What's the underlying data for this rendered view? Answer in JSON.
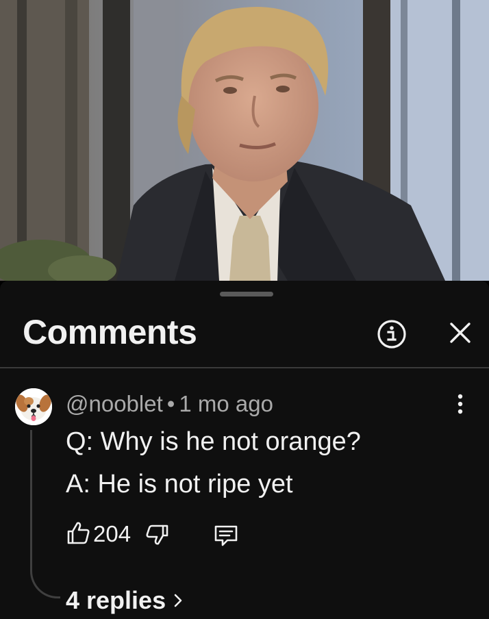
{
  "video": {
    "description_icon": "video-frame"
  },
  "comments_panel": {
    "title": "Comments",
    "info_icon": "info-icon",
    "close_icon": "close-icon"
  },
  "comment": {
    "avatar_icon": "dog-face-avatar",
    "author": "@nooblet",
    "separator": "•",
    "time": "1 mo ago",
    "lines": [
      "Q: Why is he not orange?",
      "A: He is not ripe yet"
    ],
    "like_count": "204",
    "more_icon": "more-vertical-icon",
    "like_icon": "thumbs-up-icon",
    "dislike_icon": "thumbs-down-icon",
    "reply_icon": "reply-comment-icon"
  },
  "replies": {
    "label": "4 replies",
    "icon": "chevron-right-icon"
  },
  "colors": {
    "background": "#0f0f0f",
    "text_primary": "#f1f1f1",
    "text_secondary": "#aaaaaa",
    "divider": "#3a3a3a"
  }
}
